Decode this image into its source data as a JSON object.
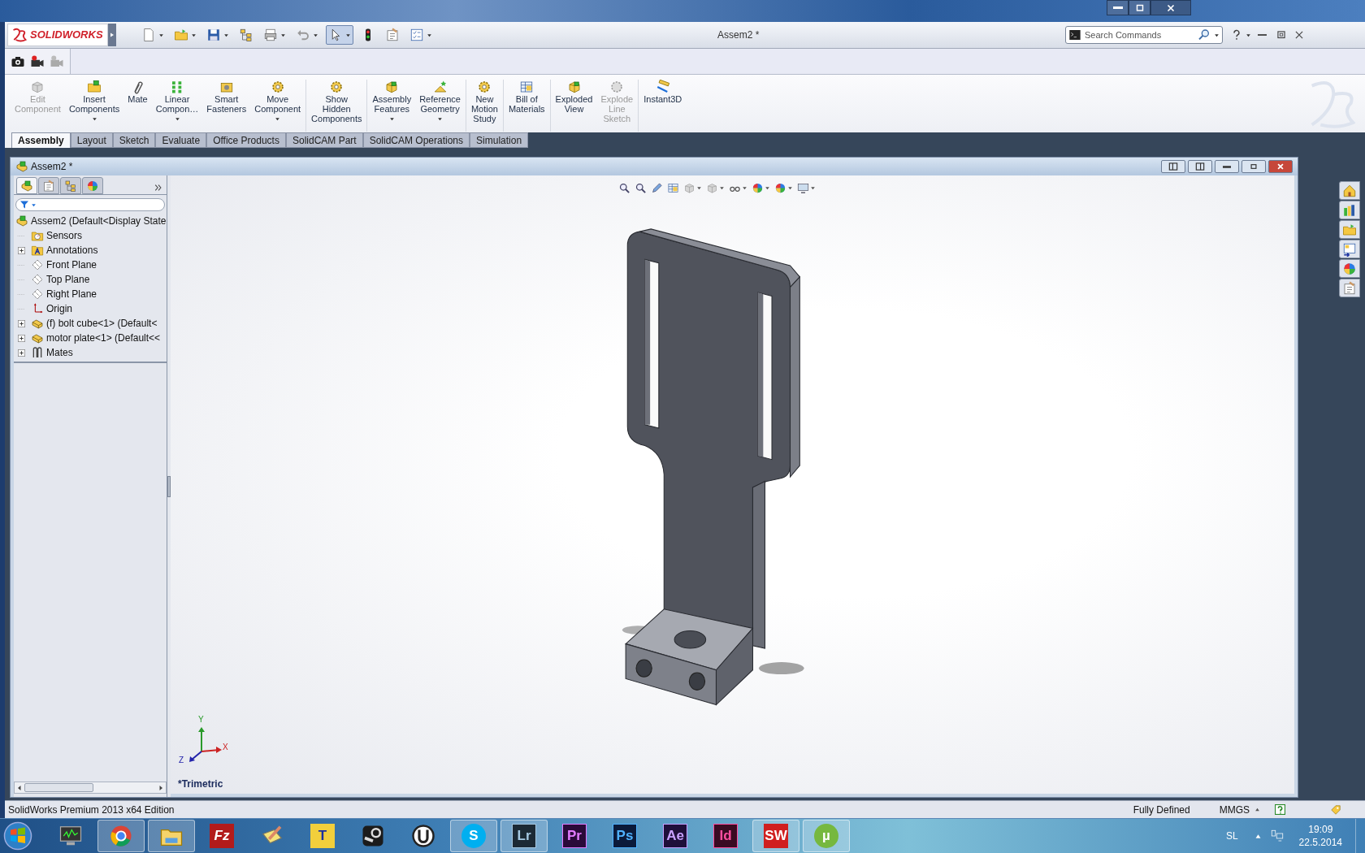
{
  "logo_text": "SOLIDWORKS",
  "window": {
    "title": "Assem2 *"
  },
  "quick_toolbar": [
    {
      "kind": "new",
      "dropdown": true,
      "selected": false
    },
    {
      "kind": "open",
      "dropdown": true,
      "selected": false
    },
    {
      "kind": "save",
      "dropdown": true,
      "selected": false
    },
    {
      "kind": "print-setup",
      "dropdown": false,
      "selected": false
    },
    {
      "kind": "print",
      "dropdown": true,
      "selected": false
    },
    {
      "kind": "undo",
      "dropdown": true,
      "selected": false
    },
    {
      "kind": "select",
      "dropdown": true,
      "selected": true
    },
    {
      "kind": "rebuild",
      "dropdown": false,
      "selected": false
    },
    {
      "kind": "options",
      "dropdown": false,
      "selected": false
    },
    {
      "kind": "checklist",
      "dropdown": true,
      "selected": false
    }
  ],
  "search": {
    "placeholder": "Search Commands"
  },
  "second_toolbar": [
    {
      "kind": "camera"
    },
    {
      "kind": "record"
    },
    {
      "kind": "record-off"
    }
  ],
  "ribbon": [
    {
      "buttons": [
        {
          "kind": "edit-component",
          "lines": [
            "Edit",
            "Component"
          ],
          "disabled": true,
          "dropdown": false
        },
        {
          "kind": "insert-components",
          "lines": [
            "Insert",
            "Components"
          ],
          "disabled": false,
          "dropdown": true
        },
        {
          "kind": "mate",
          "lines": [
            "Mate"
          ],
          "disabled": false,
          "dropdown": false
        },
        {
          "kind": "linear-pattern",
          "lines": [
            "Linear",
            "Compon…"
          ],
          "disabled": false,
          "dropdown": true
        },
        {
          "kind": "smart-fasteners",
          "lines": [
            "Smart",
            "Fasteners"
          ],
          "disabled": false,
          "dropdown": false
        },
        {
          "kind": "move-component",
          "lines": [
            "Move",
            "Component"
          ],
          "disabled": false,
          "dropdown": true
        }
      ]
    },
    {
      "buttons": [
        {
          "kind": "show-hidden",
          "lines": [
            "Show",
            "Hidden",
            "Components"
          ],
          "disabled": false,
          "dropdown": false
        }
      ]
    },
    {
      "buttons": [
        {
          "kind": "assembly-features",
          "lines": [
            "Assembly",
            "Features"
          ],
          "disabled": false,
          "dropdown": true
        },
        {
          "kind": "reference-geometry",
          "lines": [
            "Reference",
            "Geometry"
          ],
          "disabled": false,
          "dropdown": true
        }
      ]
    },
    {
      "buttons": [
        {
          "kind": "motion-study",
          "lines": [
            "New",
            "Motion",
            "Study"
          ],
          "disabled": false,
          "dropdown": false
        }
      ]
    },
    {
      "buttons": [
        {
          "kind": "bom",
          "lines": [
            "Bill of",
            "Materials"
          ],
          "disabled": false,
          "dropdown": false
        }
      ]
    },
    {
      "buttons": [
        {
          "kind": "exploded-view",
          "lines": [
            "Exploded",
            "View"
          ],
          "disabled": false,
          "dropdown": false
        },
        {
          "kind": "explode-line",
          "lines": [
            "Explode",
            "Line",
            "Sketch"
          ],
          "disabled": true,
          "dropdown": false
        }
      ]
    },
    {
      "buttons": [
        {
          "kind": "instant3d",
          "lines": [
            "Instant3D"
          ],
          "disabled": false,
          "dropdown": false
        }
      ]
    }
  ],
  "tabs": [
    {
      "label": "Assembly",
      "selected": true
    },
    {
      "label": "Layout",
      "selected": false
    },
    {
      "label": "Sketch",
      "selected": false
    },
    {
      "label": "Evaluate",
      "selected": false
    },
    {
      "label": "Office Products",
      "selected": false
    },
    {
      "label": "SolidCAM Part",
      "selected": false
    },
    {
      "label": "SolidCAM Operations",
      "selected": false
    },
    {
      "label": "Simulation",
      "selected": false
    }
  ],
  "document": {
    "title": "Assem2 *"
  },
  "panel_tabs": [
    {
      "kind": "feature-manager",
      "selected": true
    },
    {
      "kind": "property-manager",
      "selected": false
    },
    {
      "kind": "configuration-manager",
      "selected": false
    },
    {
      "kind": "display-manager",
      "selected": false
    }
  ],
  "feature_tree": [
    {
      "label": "Assem2  (Default<Display State",
      "kind": "assembly",
      "children": [
        {
          "label": "Sensors",
          "kind": "sensor-folder",
          "expandable": false
        },
        {
          "label": "Annotations",
          "kind": "annotation-folder",
          "expandable": true
        },
        {
          "label": "Front Plane",
          "kind": "plane",
          "expandable": false
        },
        {
          "label": "Top Plane",
          "kind": "plane",
          "expandable": false
        },
        {
          "label": "Right Plane",
          "kind": "plane",
          "expandable": false
        },
        {
          "label": "Origin",
          "kind": "origin",
          "expandable": false
        },
        {
          "label": "(f) bolt cube<1>  (Default<",
          "kind": "part",
          "expandable": true
        },
        {
          "label": "motor plate<1>  (Default<<",
          "kind": "part",
          "expandable": true
        },
        {
          "label": "Mates",
          "kind": "mates",
          "expandable": true
        }
      ]
    }
  ],
  "view": {
    "orientation": "*Trimetric",
    "axes": [
      "X",
      "Y",
      "Z"
    ]
  },
  "task_pane": [
    {
      "kind": "home"
    },
    {
      "kind": "library"
    },
    {
      "kind": "folder"
    },
    {
      "kind": "view-palette"
    },
    {
      "kind": "appearance"
    },
    {
      "kind": "custom-properties"
    }
  ],
  "status_bar": {
    "edition": "SolidWorks Premium 2013 x64 Edition",
    "state": "Fully Defined",
    "units": "MMGS"
  },
  "taskbar": [
    {
      "kind": "monitor",
      "running": false
    },
    {
      "kind": "chrome",
      "running": true
    },
    {
      "kind": "explorer",
      "running": true
    },
    {
      "kind": "filezilla",
      "label": "Fz",
      "running": false
    },
    {
      "kind": "notes",
      "running": false
    },
    {
      "kind": "textpad",
      "label": "T",
      "running": false
    },
    {
      "kind": "steam",
      "running": false
    },
    {
      "kind": "ble",
      "running": false
    },
    {
      "kind": "skype",
      "label": "S",
      "running": true
    },
    {
      "kind": "lightroom",
      "label": "Lr",
      "running": true
    },
    {
      "kind": "premiere",
      "label": "Pr",
      "running": false
    },
    {
      "kind": "photoshop",
      "label": "Ps",
      "running": false
    },
    {
      "kind": "aftereffects",
      "label": "Ae",
      "running": false
    },
    {
      "kind": "indesign",
      "label": "Id",
      "running": false
    },
    {
      "kind": "solidworks",
      "label": "SW",
      "running": true
    },
    {
      "kind": "utorrent",
      "label": "µ",
      "running": true
    }
  ],
  "tray": {
    "language": "SL",
    "time": "19:09",
    "date": "22.5.2014"
  }
}
